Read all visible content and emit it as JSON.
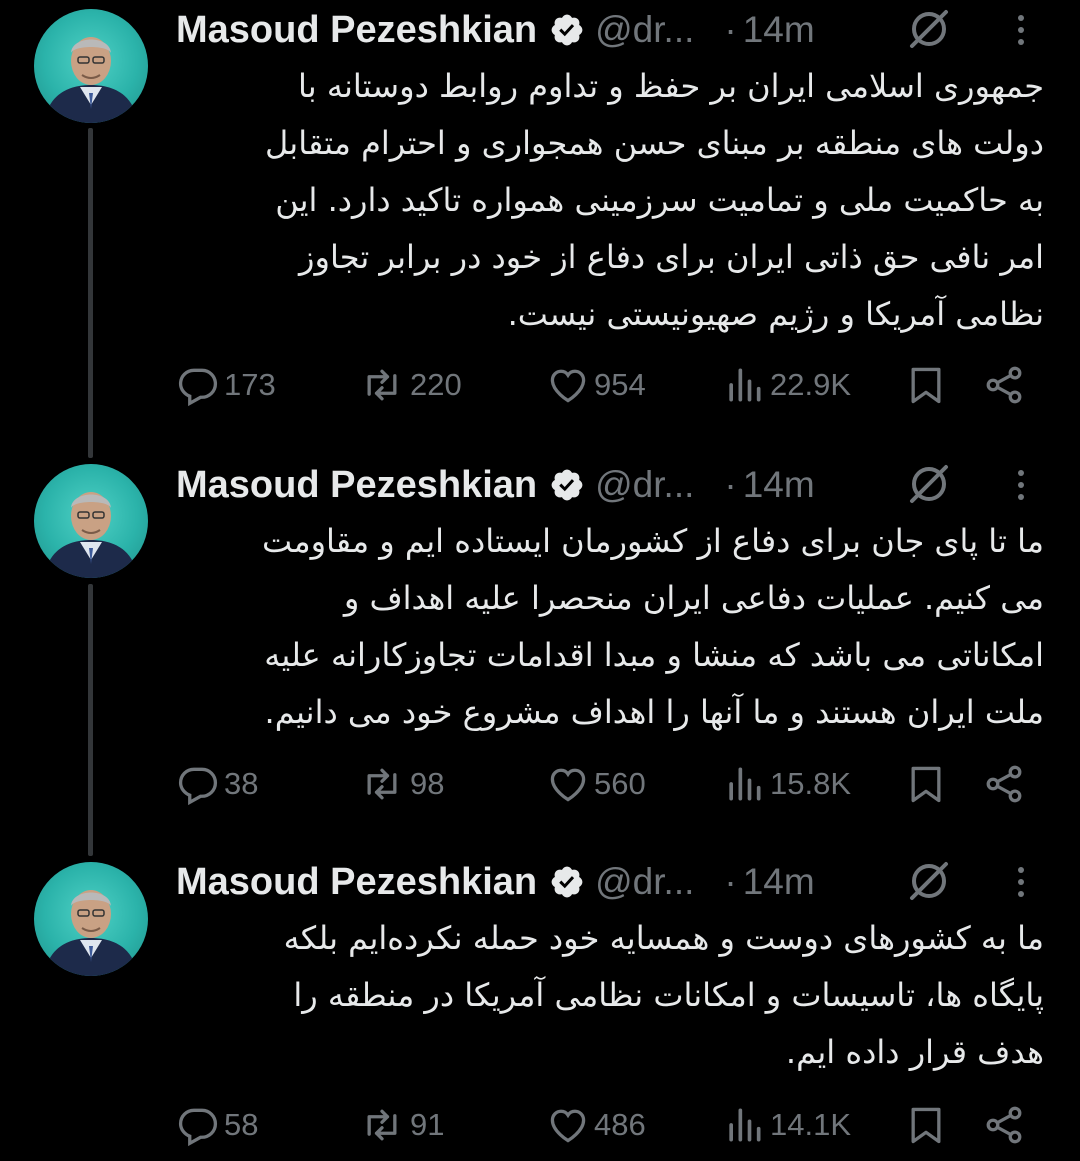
{
  "colors": {
    "background": "#000000",
    "text": "#e7e9ea",
    "muted": "#71767b",
    "verified_badge": "#e7e9ea",
    "thread_line": "#333639"
  },
  "tweets": [
    {
      "name": "Masoud Pezeshkian",
      "handle": "@dr...",
      "separator": "·",
      "time": "14m",
      "text": "جمهوری اسلامی ایران بر حفظ و تداوم روابط دوستانه با\nدولت های منطقه بر مبنای حسن همجواری و احترام متقابل\nبه حاکمیت ملی و تمامیت سرزمینی همواره تاکید دارد. این\nامر نافی حق ذاتی ایران برای دفاع از خود در برابر تجاوز\nنظامی آمریکا و رژیم صهیونیستی نیست.",
      "replies": "173",
      "reposts": "220",
      "likes": "954",
      "views": "22.9K",
      "icons": [
        "verified-icon",
        "grok-icon",
        "more-icon",
        "reply-icon",
        "repost-icon",
        "like-icon",
        "views-icon",
        "bookmark-icon",
        "share-icon"
      ]
    },
    {
      "name": "Masoud Pezeshkian",
      "handle": "@dr...",
      "separator": "·",
      "time": "14m",
      "text": "ما تا پای جان برای دفاع از کشورمان ایستاده ایم و مقاومت\nمی کنیم. عملیات دفاعی ایران منحصرا علیه اهداف و\nامکاناتی می باشد که منشا و مبدا اقدامات تجاوزکارانه علیه\nملت ایران هستند و ما آنها را اهداف مشروع خود می دانیم.",
      "replies": "38",
      "reposts": "98",
      "likes": "560",
      "views": "15.8K"
    },
    {
      "name": "Masoud Pezeshkian",
      "handle": "@dr...",
      "separator": "·",
      "time": "14m",
      "text": "ما به کشورهای دوست و همسایه خود حمله نکرده‌ایم بلکه\nپایگاه ها، تاسیسات و امکانات نظامی آمریکا در منطقه را\nهدف قرار داده ایم.",
      "replies": "58",
      "reposts": "91",
      "likes": "486",
      "views": "14.1K"
    }
  ]
}
